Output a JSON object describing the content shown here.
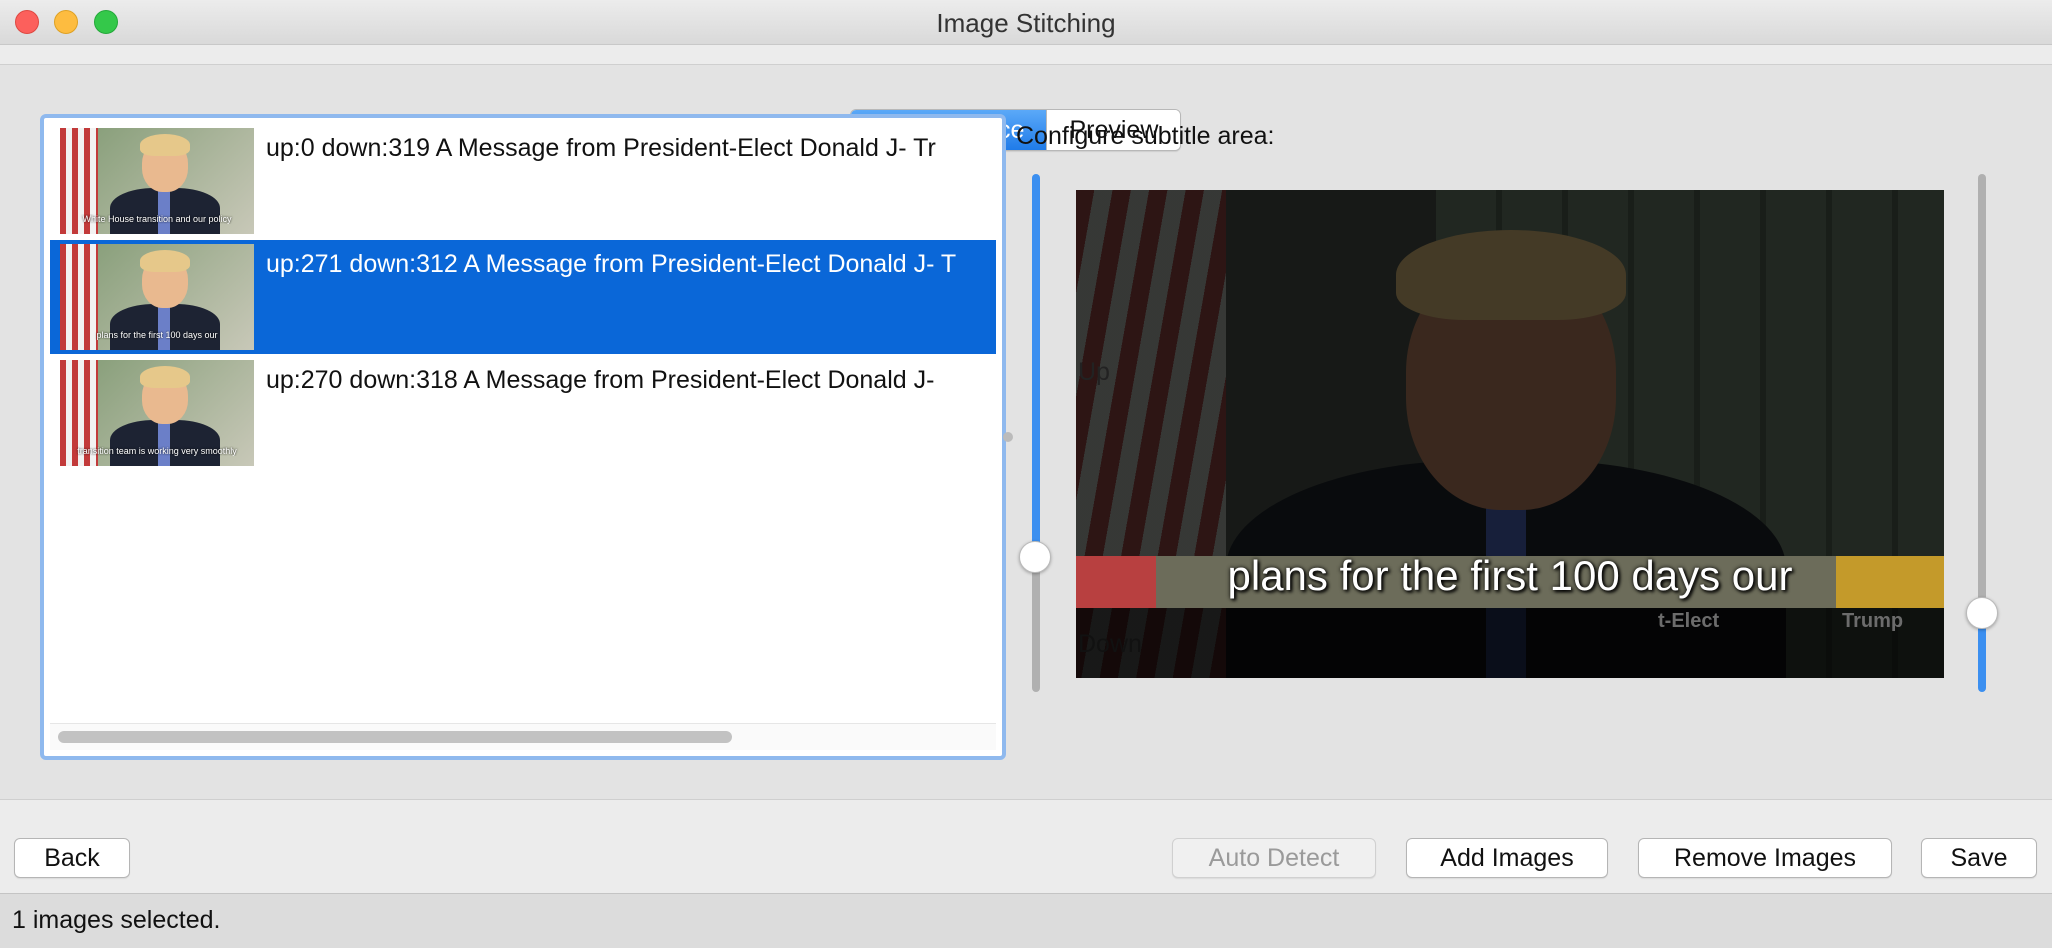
{
  "window": {
    "title": "Image Stitching"
  },
  "tabs": [
    {
      "label": "Image source",
      "active": true
    },
    {
      "label": "Preview",
      "active": false
    }
  ],
  "image_list": {
    "items": [
      {
        "text": "up:0 down:319 A Message from President-Elect Donald J- Tr",
        "thumb_caption": "White House transition and our policy",
        "selected": false
      },
      {
        "text": "up:271 down:312 A Message from President-Elect Donald J- T",
        "thumb_caption": "plans for the first 100 days our",
        "selected": true
      },
      {
        "text": "up:270 down:318 A Message from President-Elect Donald J-",
        "thumb_caption": "transition team is working very smoothly",
        "selected": false
      }
    ]
  },
  "subtitle_config": {
    "label": "Configure subtitle area:",
    "up_label": "Up",
    "down_label": "Down",
    "preview_subtitle": "plans for the first 100 days our",
    "faint_text_1": "t-Elect",
    "faint_text_2": "Trump",
    "up_slider_value": 0.25,
    "down_slider_value": 0.15
  },
  "buttons": {
    "back": "Back",
    "auto_detect": "Auto Detect",
    "add_images": "Add Images",
    "remove_images": "Remove Images",
    "save": "Save"
  },
  "status": {
    "text": "1 images selected."
  },
  "colors": {
    "accent": "#0a67d8",
    "slider_blue": "#3b8ff0"
  }
}
